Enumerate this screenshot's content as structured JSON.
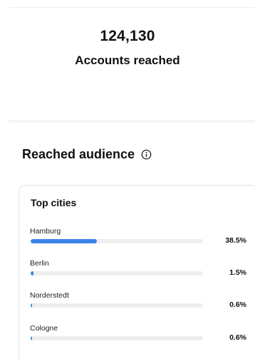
{
  "reach": {
    "count": "124,130",
    "label": "Accounts reached"
  },
  "audience": {
    "title": "Reached audience",
    "info_icon": "info-circle-icon"
  },
  "top_cities": {
    "title": "Top cities",
    "bar_color": "#3a84e6",
    "items": [
      {
        "name": "Hamburg",
        "percent_label": "38.5%",
        "share": 0.385
      },
      {
        "name": "Berlin",
        "percent_label": "1.5%",
        "share": 0.015
      },
      {
        "name": "Norderstedt",
        "percent_label": "0.6%",
        "share": 0.006
      },
      {
        "name": "Cologne",
        "percent_label": "0.6%",
        "share": 0.006
      }
    ]
  }
}
